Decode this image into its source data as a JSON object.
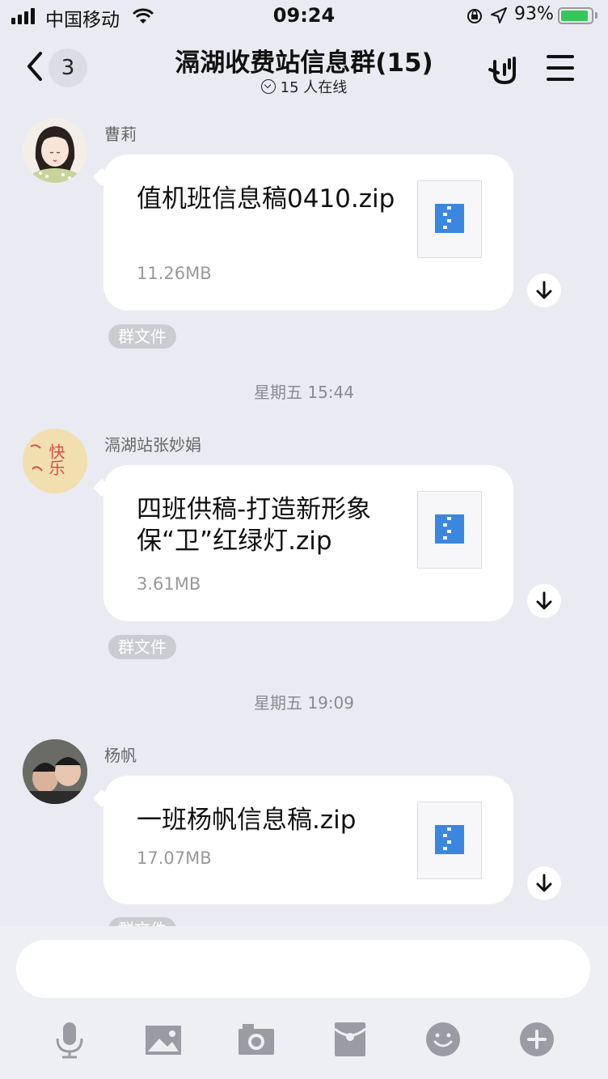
{
  "status_bar": {
    "carrier": "中国移动",
    "time": "09:24",
    "battery_percent": "93%",
    "battery_level": 0.93,
    "icons": [
      "signal-icon",
      "wifi-icon",
      "rotation-lock-icon",
      "location-icon",
      "battery-charging-icon"
    ]
  },
  "header": {
    "back_count": "3",
    "title": "滆湖收费站信息群(15)",
    "online": "15 人在线"
  },
  "messages": [
    {
      "sender": "曹莉",
      "file_name": "值机班信息稿0410.zip",
      "file_size": "11.26MB",
      "tag": "群文件"
    },
    {
      "timestamp": "星期五 15:44",
      "sender": "滆湖站张妙娟",
      "file_name": "四班供稿-打造新形象保“卫”红绿灯.zip",
      "file_size": "3.61MB",
      "tag": "群文件"
    },
    {
      "timestamp": "星期五 19:09",
      "sender": "杨帆",
      "file_name": "一班杨帆信息稿.zip",
      "file_size": "17.07MB",
      "tag": "群文件"
    }
  ],
  "avatar2_text": "快乐",
  "toolbar": [
    "microphone-icon",
    "image-icon",
    "camera-icon",
    "red-packet-icon",
    "emoji-icon",
    "plus-icon"
  ],
  "colors": {
    "accent": "#3b87e0",
    "background": "#eaebf2",
    "battery": "#35c759"
  }
}
